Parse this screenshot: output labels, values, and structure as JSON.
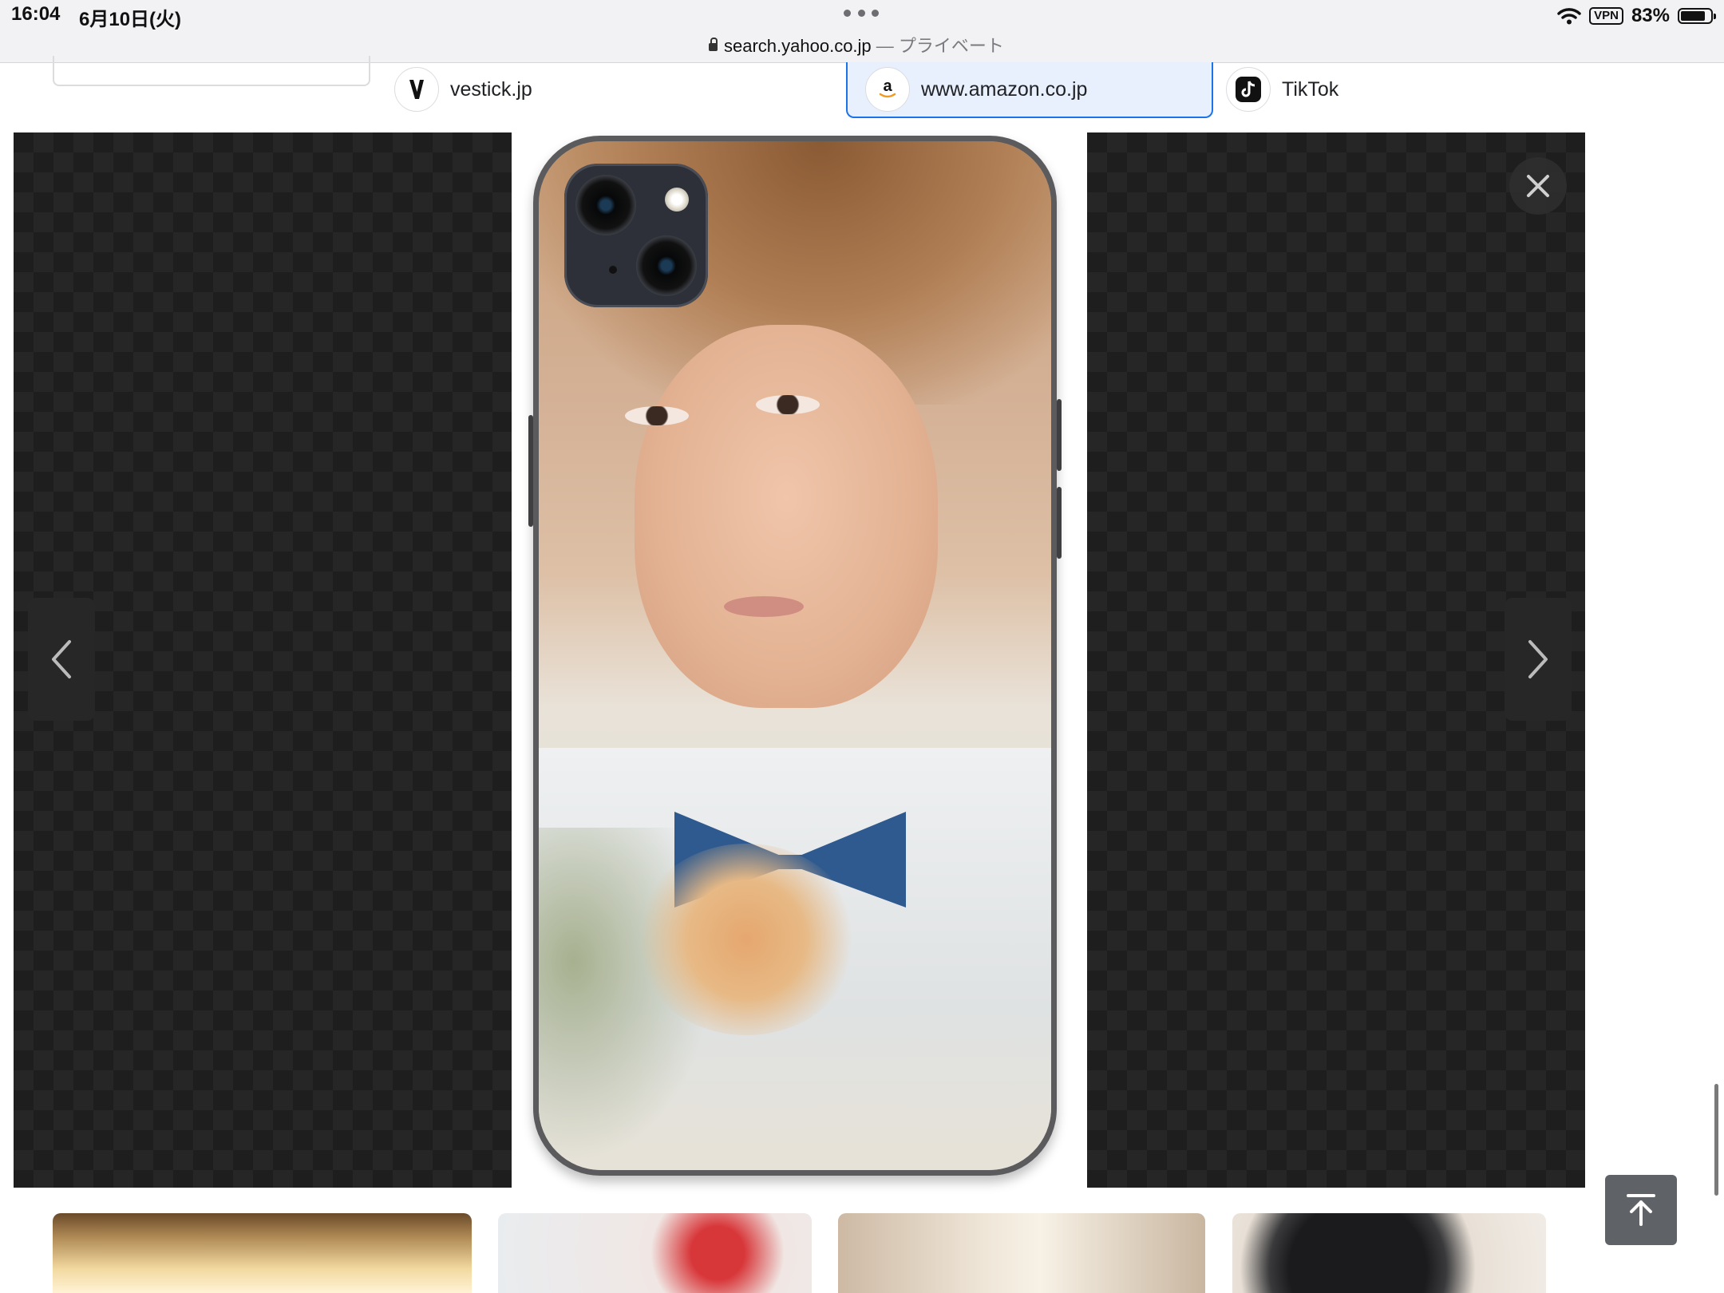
{
  "status_bar": {
    "time": "16:04",
    "date": "6月10日(火)",
    "vpn": "VPN",
    "battery": "83%"
  },
  "address_bar": {
    "domain": "search.yahoo.co.jp",
    "mode": " — プライベート"
  },
  "sources": [
    {
      "label": "vestick.jp",
      "icon": "vestick-logo-icon",
      "active": false
    },
    {
      "label": "www.amazon.co.jp",
      "icon": "amazon-logo-icon",
      "active": true
    },
    {
      "label": "TikTok",
      "icon": "tiktok-logo-icon",
      "active": false
    }
  ],
  "viewer": {
    "image": "smartphone-case-photo",
    "prev_icon": "chevron-left-icon",
    "next_icon": "chevron-right-icon",
    "close_icon": "close-icon"
  },
  "related_thumbnails": [
    {
      "name": "game-screenshot-thumbnail"
    },
    {
      "name": "glitter-case-thumbnail"
    },
    {
      "name": "portrait-thumbnail"
    },
    {
      "name": "black-phone-case-thumbnail"
    }
  ],
  "colors": {
    "accent": "#1a73e8",
    "viewer_background": "#1e1e1e",
    "scroll_top_button": "#5f6368"
  }
}
